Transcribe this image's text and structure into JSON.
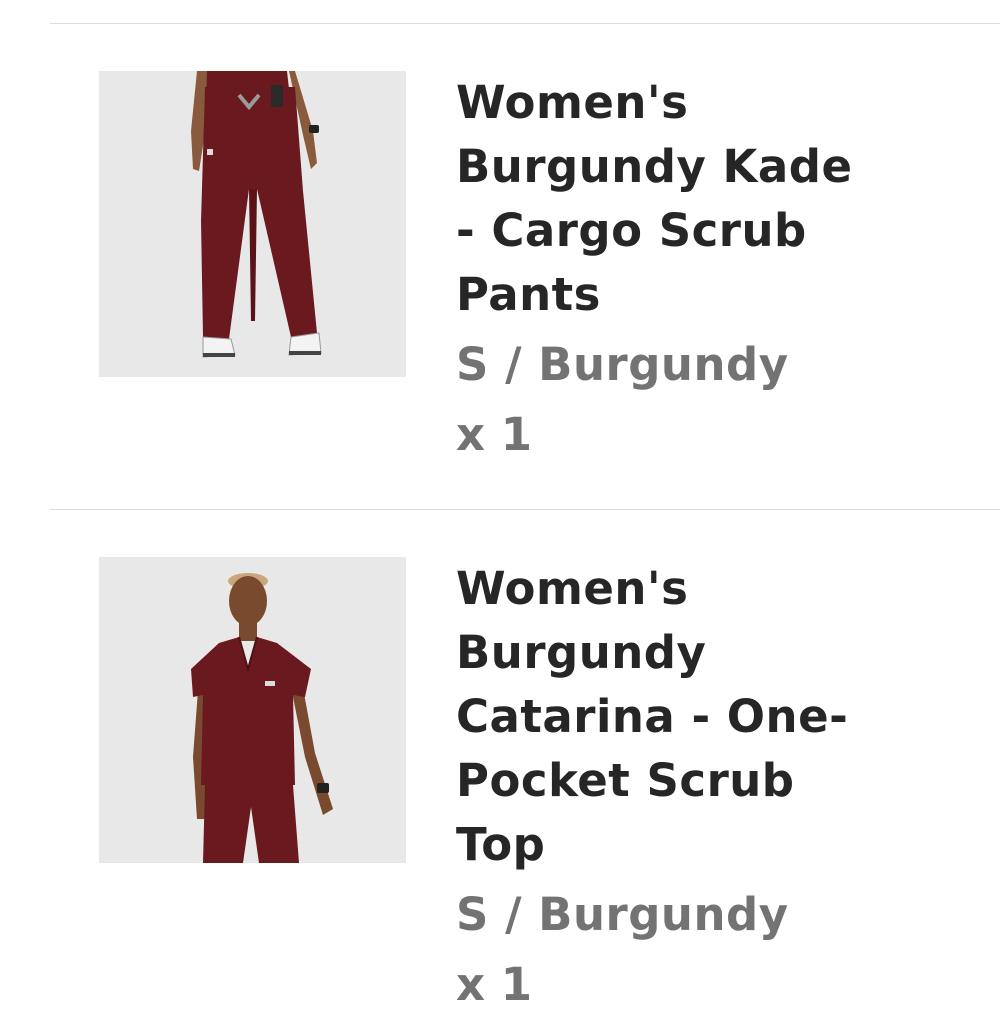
{
  "colors": {
    "background": "#ffffff",
    "divider": "#dcdcdc",
    "title_text": "#262626",
    "meta_text": "#737373",
    "thumb_bg": "#e9e8e8",
    "garment_burgundy": "#6a1a1f",
    "skin": "#8a5a3c"
  },
  "cart_items": [
    {
      "title_lines": [
        "Women's",
        "Burgundy Kade",
        "- Cargo Scrub",
        "Pants"
      ],
      "variant": "S / Burgundy",
      "quantity": "x 1",
      "image_icon": "burgundy-cargo-scrub-pants-photo"
    },
    {
      "title_lines": [
        "Women's",
        "Burgundy",
        "Catarina - One-",
        "Pocket Scrub",
        "Top"
      ],
      "variant": "S / Burgundy",
      "quantity": "x 1",
      "image_icon": "burgundy-one-pocket-scrub-top-photo"
    }
  ]
}
